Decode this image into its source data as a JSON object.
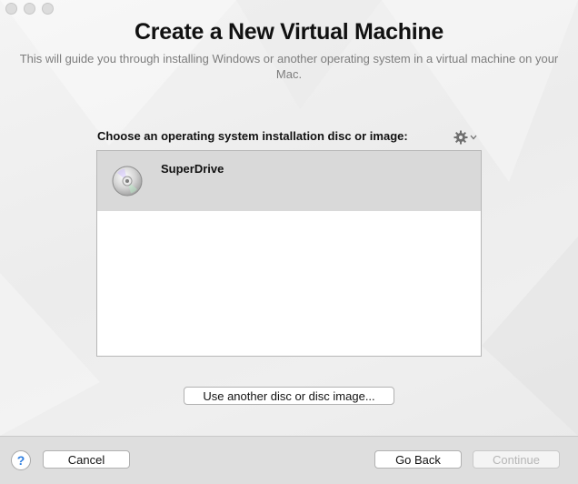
{
  "window": {
    "title": "Create a New Virtual Machine",
    "subtitle": "This will guide you through installing Windows or another operating system in a virtual machine on your Mac."
  },
  "chooser": {
    "label": "Choose an operating system installation disc or image:",
    "options_icon": "gear-icon",
    "items": [
      {
        "label": "SuperDrive",
        "icon": "disc-icon",
        "selected": true
      }
    ]
  },
  "buttons": {
    "use_another": "Use another disc or disc image...",
    "help": "?",
    "cancel": "Cancel",
    "go_back": "Go Back",
    "continue": "Continue"
  }
}
